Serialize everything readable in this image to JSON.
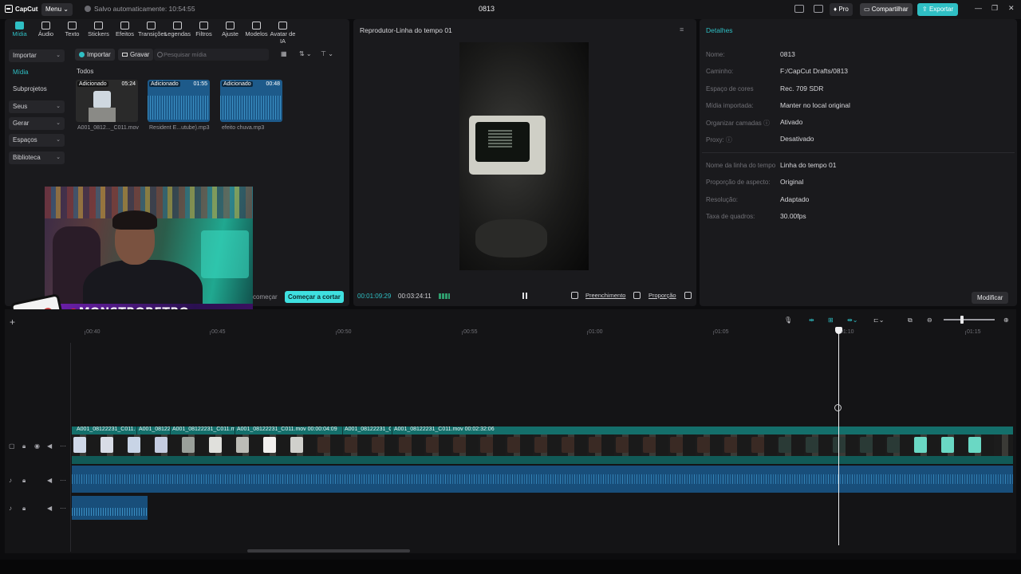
{
  "app": {
    "logo_text": "CapCut",
    "menu_label": "Menu",
    "autosave_text": "Salvo automaticamente: 10:54:55",
    "project_title": "0813",
    "pro_label": "Pro",
    "share_label": "Compartilhar",
    "export_label": "Exportar",
    "accent_color": "#2fbfc4"
  },
  "tool_tabs": [
    {
      "label": "Mídia",
      "icon": "media-icon",
      "active": true
    },
    {
      "label": "Áudio",
      "icon": "audio-icon"
    },
    {
      "label": "Texto",
      "icon": "text-icon"
    },
    {
      "label": "Stickers",
      "icon": "sticker-icon"
    },
    {
      "label": "Efeitos",
      "icon": "effects-icon"
    },
    {
      "label": "Transições",
      "icon": "transition-icon"
    },
    {
      "label": "Legendas",
      "icon": "captions-icon"
    },
    {
      "label": "Filtros",
      "icon": "filter-icon"
    },
    {
      "label": "Ajuste",
      "icon": "adjust-icon"
    },
    {
      "label": "Modelos",
      "icon": "templates-icon"
    },
    {
      "label": "Avatar de IA",
      "icon": "ai-avatar-icon"
    }
  ],
  "sidebar": {
    "items": [
      {
        "label": "Importar",
        "boxed": true
      },
      {
        "label": "Mídia",
        "active": true
      },
      {
        "label": "Subprojetos"
      },
      {
        "label": "Seus",
        "boxed": true
      },
      {
        "label": "Gerar",
        "boxed": true
      },
      {
        "label": "Espaços",
        "boxed": true
      },
      {
        "label": "Biblioteca",
        "boxed": true
      }
    ]
  },
  "media": {
    "import_label": "Importar",
    "record_label": "Gravar",
    "search_placeholder": "Pesquisar mídia",
    "section_label": "Todos",
    "clips": [
      {
        "tag": "Adicionado",
        "duration": "05:24",
        "name": "A001_0812..._C011.mov"
      },
      {
        "tag": "Adicionado",
        "duration": "01:55",
        "name": "Resident E...utube).mp3"
      },
      {
        "tag": "Adicionado",
        "duration": "00:48",
        "name": "efeito chuva.mp3"
      }
    ],
    "start_prev_label": "começar",
    "start_cut_label": "Começar a cortar"
  },
  "overlay": {
    "brand_text": "MONSTRORETRO"
  },
  "player": {
    "title": "Reprodutor-Linha do tempo 01",
    "current_time": "00:01:09:29",
    "total_time": "00:03:24:11",
    "fill_label": "Preenchimento",
    "ratio_label": "Proporção"
  },
  "details": {
    "title": "Detalhes",
    "rows_a": [
      {
        "label": "Nome:",
        "value": "0813"
      },
      {
        "label": "Caminho:",
        "value": "F:/CapCut Drafts/0813"
      },
      {
        "label": "Espaço de cores",
        "value": "Rec. 709 SDR"
      },
      {
        "label": "Mídia importada:",
        "value": "Manter no local original"
      },
      {
        "label": "Organizar camadas ⓘ",
        "value": "Ativado"
      },
      {
        "label": "Proxy: ⓘ",
        "value": "Desativado"
      }
    ],
    "rows_b": [
      {
        "label": "Nome da linha do tempo",
        "value": "Linha do tempo 01"
      },
      {
        "label": "Proporção de aspecto:",
        "value": "Original"
      },
      {
        "label": "Resolução:",
        "value": "Adaptado"
      },
      {
        "label": "Taxa de quadros:",
        "value": "30.00fps"
      }
    ],
    "modify_label": "Modificar"
  },
  "timeline": {
    "ruler": [
      "00:40",
      "00:45",
      "00:50",
      "00:55",
      "01:00",
      "01:05",
      "01:10",
      "01:15"
    ],
    "video_clips": [
      {
        "name": "A001_08122231_C011.m"
      },
      {
        "name": "A001_081222"
      },
      {
        "name": "A001_08122231_C011.mo"
      },
      {
        "name": "A001_08122231_C011.mov  00:00:04:09"
      },
      {
        "name": "A001_08122231_C("
      },
      {
        "name": "A001_08122231_C011.mov  00:02:32:06"
      }
    ]
  }
}
